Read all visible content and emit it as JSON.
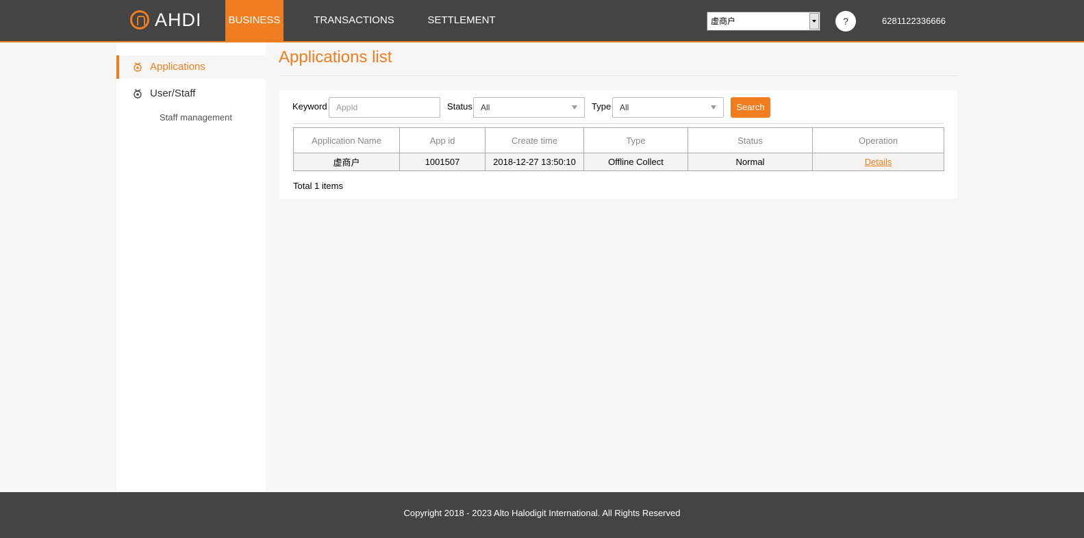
{
  "header": {
    "logo_text": "AHDI",
    "nav": [
      {
        "label": "BUSINESS",
        "active": true
      },
      {
        "label": "TRANSACTIONS",
        "active": false
      },
      {
        "label": "SETTLEMENT",
        "active": false
      }
    ],
    "merchant_selected": "虚商户",
    "help_label": "?",
    "user_id": "6281122336666"
  },
  "sidebar": {
    "items": [
      {
        "label": "Applications",
        "active": true
      },
      {
        "label": "User/Staff",
        "active": false
      }
    ],
    "subitems": [
      {
        "label": "Staff management"
      }
    ]
  },
  "main": {
    "title": "Applications list",
    "filters": {
      "keyword_label": "Keyword",
      "keyword_placeholder": "AppId",
      "status_label": "Status",
      "status_value": "All",
      "type_label": "Type",
      "type_value": "All",
      "search_label": "Search"
    },
    "table": {
      "columns": [
        "Application Name",
        "App id",
        "Create time",
        "Type",
        "Status",
        "Operation"
      ],
      "rows": [
        {
          "name": "虚商户",
          "app_id": "1001507",
          "create_time": "2018-12-27 13:50:10",
          "type": "Offline Collect",
          "status": "Normal",
          "operation": "Details"
        }
      ]
    },
    "total_text": "Total 1 items"
  },
  "footer": {
    "copyright": "Copyright 2018 - 2023 Alto Halodigit International. All Rights Reserved"
  },
  "colors": {
    "accent": "#f07d1f",
    "header_bg": "#444444",
    "page_bg": "#f7f6f4"
  }
}
